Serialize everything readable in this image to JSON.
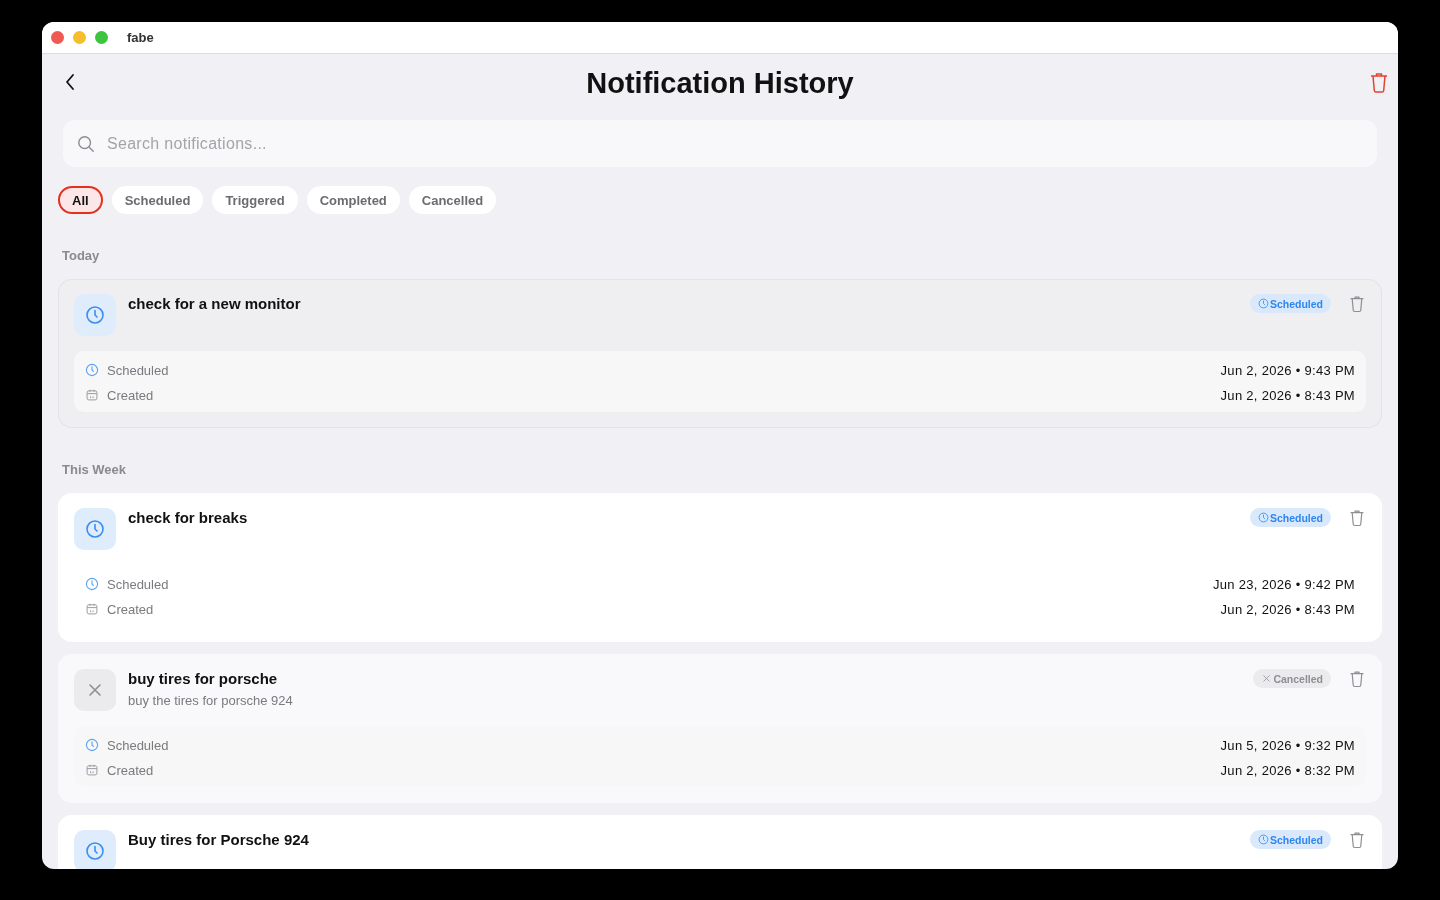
{
  "window": {
    "title": "fabe"
  },
  "header": {
    "title": "Notification History"
  },
  "search": {
    "placeholder": "Search notifications..."
  },
  "filters": [
    {
      "label": "All",
      "selected": true
    },
    {
      "label": "Scheduled",
      "selected": false
    },
    {
      "label": "Triggered",
      "selected": false
    },
    {
      "label": "Completed",
      "selected": false
    },
    {
      "label": "Cancelled",
      "selected": false
    }
  ],
  "sections": [
    {
      "label": "Today",
      "items": [
        {
          "title": "check for a new monitor",
          "hovered": true,
          "status": {
            "kind": "scheduled",
            "label": "Scheduled"
          },
          "details": [
            {
              "kind": "scheduled",
              "label": "Scheduled",
              "value": "Jun 2, 2026 • 9:43 PM"
            },
            {
              "kind": "created",
              "label": "Created",
              "value": "Jun 2, 2026 • 8:43 PM"
            }
          ]
        }
      ]
    },
    {
      "label": "This Week",
      "items": [
        {
          "title": "check for breaks",
          "hovered": false,
          "status": {
            "kind": "scheduled",
            "label": "Scheduled"
          },
          "details": [
            {
              "kind": "scheduled",
              "label": "Scheduled",
              "value": "Jun 23, 2026 • 9:42 PM"
            },
            {
              "kind": "created",
              "label": "Created",
              "value": "Jun 2, 2026 • 8:43 PM"
            }
          ]
        },
        {
          "title": "buy tires for porsche",
          "subtitle": "buy the tires for porsche 924",
          "hovered": false,
          "status": {
            "kind": "cancelled",
            "label": "Cancelled"
          },
          "details": [
            {
              "kind": "scheduled",
              "label": "Scheduled",
              "value": "Jun 5, 2026 • 9:32 PM"
            },
            {
              "kind": "created",
              "label": "Created",
              "value": "Jun 2, 2026 • 8:32 PM"
            }
          ]
        },
        {
          "title": "Buy tires for Porsche 924",
          "hovered": false,
          "status": {
            "kind": "scheduled",
            "label": "Scheduled"
          }
        }
      ]
    }
  ]
}
